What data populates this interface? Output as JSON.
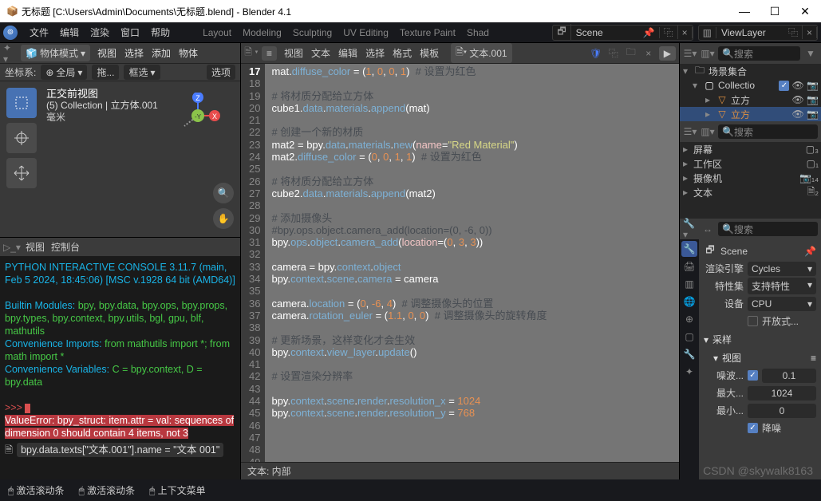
{
  "title_bar": {
    "icon": "blender-icon",
    "title": "无标题 [C:\\Users\\Admin\\Documents\\无标题.blend] - Blender 4.1",
    "min": "window-minimize",
    "max": "window-maximize",
    "close": "window-close"
  },
  "menu": {
    "items": [
      "文件",
      "编辑",
      "渲染",
      "窗口",
      "帮助"
    ],
    "tabs": [
      "Layout",
      "Modeling",
      "Sculpting",
      "UV Editing",
      "Texture Paint",
      "Shad"
    ]
  },
  "scene_bar": {
    "scene_label": "Scene",
    "layer_label": "ViewLayer"
  },
  "viewport": {
    "header_mode": "物体模式",
    "header_menus": [
      "视图",
      "选择",
      "添加",
      "物体"
    ],
    "coord": {
      "label": "坐标系:",
      "value": "全局",
      "drag": "拖...",
      "box": "框选",
      "opts": "选项"
    },
    "overlay": {
      "title": "正交前视图",
      "subtitle": "(5) Collection | 立方体.001",
      "unit": "毫米"
    }
  },
  "console": {
    "menus": [
      "视图",
      "控制台"
    ],
    "l1": "PYTHON INTERACTIVE CONSOLE 3.11.7 (main, Feb  5 2024, 18:45:06) [MSC v.1928 64 bit (AMD64)]",
    "l2a": "Builtin Modules:     ",
    "l2b": "bpy, bpy.data, bpy.ops, bpy.props, bpy.types, bpy.context, bpy.utils, bgl, gpu, blf, mathutils",
    "l3a": "Convenience Imports: ",
    "l3b": "from mathutils import *; from math import *",
    "l4a": "Convenience Variables: ",
    "l4b": "C = bpy.context, D = bpy.data",
    "prompt": ">>> ",
    "err": "  ValueError: bpy_struct: item.attr = val: sequences of dimension 0 should contain 4 items, not 3",
    "file_expr": "bpy.data.texts[\"文本.001\"].name = \"文本 001\""
  },
  "text_editor": {
    "menus": [
      "视图",
      "文本",
      "编辑",
      "选择",
      "格式",
      "模板"
    ],
    "file": "文本.001",
    "footer": "文本: 内部"
  },
  "code_lines": [
    {
      "n": 17,
      "seg": [
        [
          "mat",
          "kw"
        ],
        [
          ".",
          "dot"
        ],
        [
          "diffuse_color",
          "fn"
        ],
        [
          " = ",
          "dot"
        ],
        [
          "(",
          "par"
        ],
        [
          "1",
          "num"
        ],
        [
          ", ",
          "dot"
        ],
        [
          "0",
          "num"
        ],
        [
          ", ",
          "dot"
        ],
        [
          "0",
          "num"
        ],
        [
          ", ",
          "dot"
        ],
        [
          "1",
          "num"
        ],
        [
          ")",
          "par"
        ],
        [
          "  ",
          "dot"
        ],
        [
          "# 设置为红色",
          "cm"
        ]
      ]
    },
    {
      "n": 18,
      "seg": []
    },
    {
      "n": 19,
      "seg": [
        [
          "# 将材质分配给立方体",
          "cm"
        ]
      ]
    },
    {
      "n": 20,
      "seg": [
        [
          "cube1",
          "kw"
        ],
        [
          ".",
          "dot"
        ],
        [
          "data",
          "fn"
        ],
        [
          ".",
          "dot"
        ],
        [
          "materials",
          "fn"
        ],
        [
          ".",
          "dot"
        ],
        [
          "append",
          "fn"
        ],
        [
          "(",
          "par"
        ],
        [
          "mat",
          "kw"
        ],
        [
          ")",
          "par"
        ]
      ]
    },
    {
      "n": 21,
      "seg": []
    },
    {
      "n": 22,
      "seg": [
        [
          "# 创建一个新的材质",
          "cm"
        ]
      ]
    },
    {
      "n": 23,
      "seg": [
        [
          "mat2",
          "kw"
        ],
        [
          " = ",
          "dot"
        ],
        [
          "bpy",
          "kw"
        ],
        [
          ".",
          "dot"
        ],
        [
          "data",
          "fn"
        ],
        [
          ".",
          "dot"
        ],
        [
          "materials",
          "fn"
        ],
        [
          ".",
          "dot"
        ],
        [
          "new",
          "fn"
        ],
        [
          "(",
          "par"
        ],
        [
          "name",
          "arg"
        ],
        [
          "=",
          "dot"
        ],
        [
          "\"Red Material\"",
          "str"
        ],
        [
          ")",
          "par"
        ]
      ]
    },
    {
      "n": 24,
      "seg": [
        [
          "mat2",
          "kw"
        ],
        [
          ".",
          "dot"
        ],
        [
          "diffuse_color",
          "fn"
        ],
        [
          " = ",
          "dot"
        ],
        [
          "(",
          "par"
        ],
        [
          "0",
          "num"
        ],
        [
          ", ",
          "dot"
        ],
        [
          "0",
          "num"
        ],
        [
          ", ",
          "dot"
        ],
        [
          "1",
          "num"
        ],
        [
          ", ",
          "dot"
        ],
        [
          "1",
          "num"
        ],
        [
          ")",
          "par"
        ],
        [
          "  ",
          "dot"
        ],
        [
          "# 设置为红色",
          "cm"
        ]
      ]
    },
    {
      "n": 25,
      "seg": []
    },
    {
      "n": 26,
      "seg": [
        [
          "# 将材质分配给立方体",
          "cm"
        ]
      ]
    },
    {
      "n": 27,
      "seg": [
        [
          "cube2",
          "kw"
        ],
        [
          ".",
          "dot"
        ],
        [
          "data",
          "fn"
        ],
        [
          ".",
          "dot"
        ],
        [
          "materials",
          "fn"
        ],
        [
          ".",
          "dot"
        ],
        [
          "append",
          "fn"
        ],
        [
          "(",
          "par"
        ],
        [
          "mat2",
          "kw"
        ],
        [
          ")",
          "par"
        ]
      ]
    },
    {
      "n": 28,
      "seg": []
    },
    {
      "n": 29,
      "seg": [
        [
          "# 添加摄像头",
          "cm"
        ]
      ]
    },
    {
      "n": 30,
      "seg": [
        [
          "#bpy.ops.object.camera_add(location=(0, -6, 0))",
          "cm"
        ]
      ]
    },
    {
      "n": 31,
      "seg": [
        [
          "bpy",
          "kw"
        ],
        [
          ".",
          "dot"
        ],
        [
          "ops",
          "fn"
        ],
        [
          ".",
          "dot"
        ],
        [
          "object",
          "fn"
        ],
        [
          ".",
          "dot"
        ],
        [
          "camera_add",
          "fn"
        ],
        [
          "(",
          "par"
        ],
        [
          "location",
          "arg"
        ],
        [
          "=",
          "dot"
        ],
        [
          "(",
          "par"
        ],
        [
          "0",
          "num"
        ],
        [
          ", ",
          "dot"
        ],
        [
          "3",
          "num"
        ],
        [
          ", ",
          "dot"
        ],
        [
          "3",
          "num"
        ],
        [
          "))",
          "par"
        ]
      ]
    },
    {
      "n": 32,
      "seg": []
    },
    {
      "n": 33,
      "seg": [
        [
          "camera",
          "kw"
        ],
        [
          " = ",
          "dot"
        ],
        [
          "bpy",
          "kw"
        ],
        [
          ".",
          "dot"
        ],
        [
          "context",
          "fn"
        ],
        [
          ".",
          "dot"
        ],
        [
          "object",
          "fn"
        ]
      ]
    },
    {
      "n": 34,
      "seg": [
        [
          "bpy",
          "kw"
        ],
        [
          ".",
          "dot"
        ],
        [
          "context",
          "fn"
        ],
        [
          ".",
          "dot"
        ],
        [
          "scene",
          "fn"
        ],
        [
          ".",
          "dot"
        ],
        [
          "camera",
          "fn"
        ],
        [
          " = ",
          "dot"
        ],
        [
          "camera",
          "kw"
        ]
      ]
    },
    {
      "n": 35,
      "seg": []
    },
    {
      "n": 36,
      "seg": [
        [
          "camera",
          "kw"
        ],
        [
          ".",
          "dot"
        ],
        [
          "location",
          "fn"
        ],
        [
          " = ",
          "dot"
        ],
        [
          "(",
          "par"
        ],
        [
          "0",
          "num"
        ],
        [
          ", ",
          "dot"
        ],
        [
          "-6",
          "num"
        ],
        [
          ", ",
          "dot"
        ],
        [
          "4",
          "num"
        ],
        [
          ")",
          "par"
        ],
        [
          "  ",
          "dot"
        ],
        [
          "# 调整摄像头的位置",
          "cm"
        ]
      ]
    },
    {
      "n": 37,
      "seg": [
        [
          "camera",
          "kw"
        ],
        [
          ".",
          "dot"
        ],
        [
          "rotation_euler",
          "fn"
        ],
        [
          " = ",
          "dot"
        ],
        [
          "(",
          "par"
        ],
        [
          "1.1",
          "num"
        ],
        [
          ", ",
          "dot"
        ],
        [
          "0",
          "num"
        ],
        [
          ", ",
          "dot"
        ],
        [
          "0",
          "num"
        ],
        [
          ")",
          "par"
        ],
        [
          "  ",
          "dot"
        ],
        [
          "# 调整摄像头的旋转角度",
          "cm"
        ]
      ]
    },
    {
      "n": 38,
      "seg": []
    },
    {
      "n": 39,
      "seg": [
        [
          "# 更新场景，这样变化才会生效",
          "cm"
        ]
      ]
    },
    {
      "n": 40,
      "seg": [
        [
          "bpy",
          "kw"
        ],
        [
          ".",
          "dot"
        ],
        [
          "context",
          "fn"
        ],
        [
          ".",
          "dot"
        ],
        [
          "view_layer",
          "fn"
        ],
        [
          ".",
          "dot"
        ],
        [
          "update",
          "fn"
        ],
        [
          "()",
          "par"
        ]
      ]
    },
    {
      "n": 41,
      "seg": []
    },
    {
      "n": 42,
      "seg": [
        [
          "# 设置渲染分辨率",
          "cm"
        ]
      ]
    },
    {
      "n": 43,
      "seg": []
    },
    {
      "n": 44,
      "seg": [
        [
          "bpy",
          "kw"
        ],
        [
          ".",
          "dot"
        ],
        [
          "context",
          "fn"
        ],
        [
          ".",
          "dot"
        ],
        [
          "scene",
          "fn"
        ],
        [
          ".",
          "dot"
        ],
        [
          "render",
          "fn"
        ],
        [
          ".",
          "dot"
        ],
        [
          "resolution_x",
          "fn"
        ],
        [
          " = ",
          "dot"
        ],
        [
          "1024",
          "num"
        ]
      ]
    },
    {
      "n": 45,
      "seg": [
        [
          "bpy",
          "kw"
        ],
        [
          ".",
          "dot"
        ],
        [
          "context",
          "fn"
        ],
        [
          ".",
          "dot"
        ],
        [
          "scene",
          "fn"
        ],
        [
          ".",
          "dot"
        ],
        [
          "render",
          "fn"
        ],
        [
          ".",
          "dot"
        ],
        [
          "resolution_y",
          "fn"
        ],
        [
          " = ",
          "dot"
        ],
        [
          "768",
          "num"
        ]
      ]
    },
    {
      "n": 46,
      "seg": []
    },
    {
      "n": 47,
      "seg": []
    },
    {
      "n": 48,
      "seg": []
    },
    {
      "n": 49,
      "seg": []
    }
  ],
  "outliner": {
    "root": "场景集合",
    "collection": "Collectio",
    "items": [
      "立方",
      "立方"
    ],
    "search": "搜索",
    "bottom": [
      "屏幕",
      "工作区",
      "摄像机",
      "文本"
    ]
  },
  "props": {
    "search": "搜索",
    "scene": "Scene",
    "engine_label": "渲染引擎",
    "engine_val": "Cycles",
    "feature_label": "特性集",
    "feature_val": "支持特性",
    "device_label": "设备",
    "device_val": "CPU",
    "shading": "开放式...",
    "sampling": "采样",
    "viewport": "视图",
    "noise": "噪波...",
    "noise_val": "0.1",
    "max": "最大...",
    "max_val": "1024",
    "min": "最小...",
    "min_val": "0",
    "denoise": "降噪"
  },
  "status": {
    "s1": "激活滚动条",
    "s2": "激活滚动条",
    "s3": "上下文菜单"
  },
  "watermark": "CSDN @skywalk8163"
}
